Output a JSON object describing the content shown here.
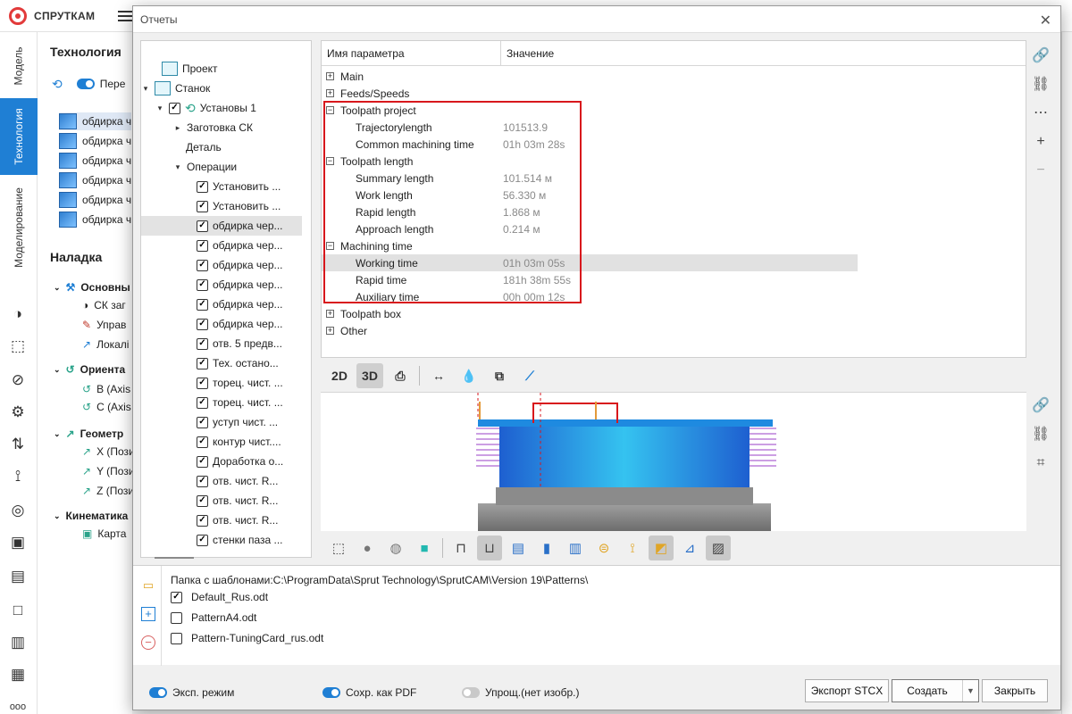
{
  "app": {
    "brand": "СПРУТКАМ",
    "rail_tabs": [
      "Модель",
      "Технология",
      "Моделирование"
    ],
    "panel_title": "Технология",
    "panel_toggle_label": "Пере",
    "operations_short": [
      "обдирка ч",
      "обдирка ч",
      "обдирка ч",
      "обдирка ч",
      "обдирка ч",
      "обдирка ч"
    ],
    "setup_title": "Наладка",
    "setup_groups": [
      {
        "label": "Основны",
        "items": [
          "СК заг",
          "Управ",
          "Локалі"
        ]
      },
      {
        "label": "Ориента",
        "items": [
          "B (Axis",
          "C (Axis"
        ]
      },
      {
        "label": "Геометр",
        "items": [
          "X (Пози",
          "Y (Пози",
          "Z (Пози"
        ]
      },
      {
        "label": "Кинематика",
        "items": [
          "Карта"
        ]
      }
    ]
  },
  "dialog": {
    "title": "Отчеты",
    "tree": {
      "project": "Проект",
      "machine": "Станок",
      "setup": "Установы 1",
      "stock_cs": "Заготовка СК",
      "part": "Деталь",
      "operations": "Операции",
      "ops": [
        "Установить ...",
        "Установить ...",
        "обдирка чер...",
        "обдирка чер...",
        "обдирка чер...",
        "обдирка чер...",
        "обдирка чер...",
        "обдирка чер...",
        "отв. 5 предв...",
        "Тех. остано...",
        "торец. чист. ...",
        "торец. чист. ...",
        "уступ чист. ...",
        "контур чист....",
        "Доработка о...",
        "отв. чист. R...",
        "отв. чист. R...",
        "отв. чист. R...",
        "стенки паза ..."
      ]
    },
    "grid": {
      "col_name": "Имя параметра",
      "col_value": "Значение",
      "rows": [
        {
          "type": "group",
          "name": "Main",
          "sign": "+"
        },
        {
          "type": "group",
          "name": "Feeds/Speeds",
          "sign": "+"
        },
        {
          "type": "group",
          "name": "Toolpath project",
          "sign": "−"
        },
        {
          "type": "item",
          "name": "Trajectorylength",
          "value": "101513.9"
        },
        {
          "type": "item",
          "name": "Common machining time",
          "value": "01h 03m 28s"
        },
        {
          "type": "group",
          "name": "Toolpath length",
          "sign": "−"
        },
        {
          "type": "item",
          "name": "Summary length",
          "value": "101.514 м"
        },
        {
          "type": "item",
          "name": "Work length",
          "value": "56.330 м"
        },
        {
          "type": "item",
          "name": "Rapid length",
          "value": "1.868 м"
        },
        {
          "type": "item",
          "name": "Approach length",
          "value": "0.214 м"
        },
        {
          "type": "group",
          "name": "Machining time",
          "sign": "−"
        },
        {
          "type": "item",
          "name": "Working time",
          "value": "01h 03m 05s",
          "highlight": true
        },
        {
          "type": "item",
          "name": "Rapid time",
          "value": "181h 38m 55s"
        },
        {
          "type": "item",
          "name": "Auxiliary time",
          "value": "00h 00m 12s"
        },
        {
          "type": "group",
          "name": "Toolpath box",
          "sign": "+"
        },
        {
          "type": "group",
          "name": "Other",
          "sign": "+"
        }
      ]
    },
    "viewer": {
      "btn_2d": "2D",
      "btn_3d": "3D"
    },
    "templates": {
      "folder_label": "Папка с шаблонами:C:\\ProgramData\\Sprut Technology\\SprutCAM\\Version 19\\Patterns\\",
      "items": [
        {
          "name": "Default_Rus.odt",
          "checked": true
        },
        {
          "name": "PatternA4.odt",
          "checked": false
        },
        {
          "name": "Pattern-TuningCard_rus.odt",
          "checked": false
        }
      ]
    },
    "footer": {
      "exp_mode": "Эксп. режим",
      "save_pdf": "Сохр. как PDF",
      "simplified": "Упрощ.(нет изобр.)",
      "export_btn": "Экспорт STCX",
      "create_btn": "Создать",
      "close_btn": "Закрыть"
    }
  }
}
